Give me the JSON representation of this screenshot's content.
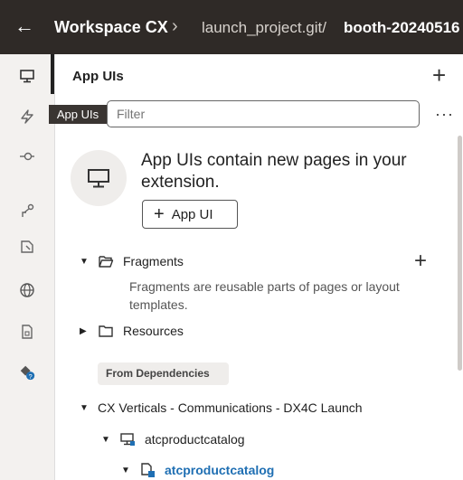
{
  "topbar": {
    "back_icon": "back-arrow-icon",
    "workspace": "Workspace CX",
    "separator": "›",
    "path": "launch_project.git/",
    "branch": "booth-20240516"
  },
  "rail": {
    "items": [
      {
        "icon": "desktop-icon",
        "active": true
      },
      {
        "icon": "lightning-icon"
      },
      {
        "icon": "git-commit-icon"
      },
      {
        "icon": "process-flow-icon"
      },
      {
        "icon": "component-icon"
      },
      {
        "icon": "globe-icon"
      },
      {
        "icon": "document-icon"
      },
      {
        "icon": "dependency-icon"
      }
    ]
  },
  "tooltip": "App UIs",
  "panel": {
    "title": "App UIs",
    "add_label": "+",
    "filter_placeholder": "Filter",
    "more_label": "···"
  },
  "empty_state": {
    "message": "App UIs contain new pages in your extension.",
    "button_icon": "+",
    "button_label": "App UI"
  },
  "tree": {
    "fragments": {
      "label": "Fragments",
      "add_label": "+",
      "description": "Fragments are reusable parts of pages or layout templates."
    },
    "resources": {
      "label": "Resources"
    },
    "dependencies_chip": "From Dependencies",
    "cx_verticals": {
      "label": "CX Verticals - Communications - DX4C Launch"
    },
    "atcproductcatalog_app": {
      "label": "atcproductcatalog"
    },
    "atcproductcatalog_flow": {
      "label": "atcproductcatalog"
    }
  },
  "colors": {
    "topbar": "#2f2a27",
    "link": "#1f6fb3",
    "rail": "#f3f1ef"
  }
}
